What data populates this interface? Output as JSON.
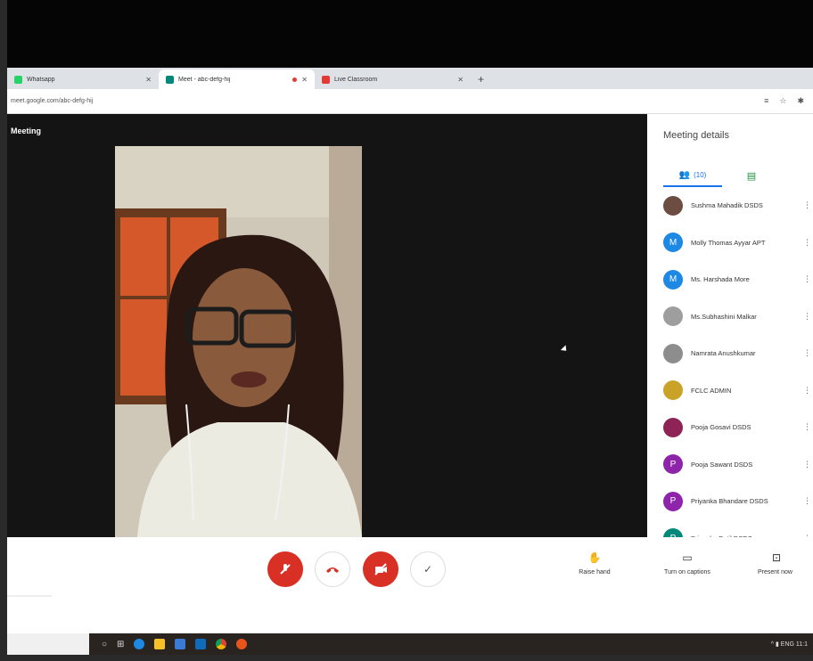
{
  "browser": {
    "tabs": [
      {
        "title": "Whatsapp",
        "favicon_color": "#25d366"
      },
      {
        "title": "Meet - abc-defg-hij",
        "favicon_color": "#00897b"
      },
      {
        "title": "Live Classroom",
        "favicon_color": "#e53935"
      }
    ],
    "new_tab": "+",
    "url": "meet.google.com/abc-defg-hij"
  },
  "meeting": {
    "title": "Meeting"
  },
  "panel": {
    "title": "Meeting details",
    "people_tab_label": "(10)",
    "participants": [
      {
        "name": "Sushma Mahadik DSDS",
        "initial": "",
        "color": "#6d4c41"
      },
      {
        "name": "Molly Thomas Ayyar APT",
        "initial": "M",
        "color": "#1e88e5"
      },
      {
        "name": "Ms. Harshada More",
        "initial": "M",
        "color": "#1e88e5"
      },
      {
        "name": "Ms.Subhashini Malkar",
        "initial": "",
        "color": "#9e9e9e"
      },
      {
        "name": "Namrata Anushkumar",
        "initial": "",
        "color": "#8d8d8d"
      },
      {
        "name": "FCLC ADMIN",
        "initial": "",
        "color": "#c9a227"
      },
      {
        "name": "Pooja Gosavi DSDS",
        "initial": "",
        "color": "#8e2456"
      },
      {
        "name": "Pooja Sawant DSDS",
        "initial": "P",
        "color": "#8e24aa"
      },
      {
        "name": "Priyanka Bhandare DSDS",
        "initial": "P",
        "color": "#8e24aa"
      },
      {
        "name": "Priyanka Patil DSDS",
        "initial": "P",
        "color": "#00897b"
      }
    ]
  },
  "controls": {
    "actions": [
      {
        "label": "Raise hand",
        "icon": "hand-icon"
      },
      {
        "label": "Turn on captions",
        "icon": "captions-icon"
      },
      {
        "label": "Present now",
        "icon": "present-icon"
      }
    ]
  },
  "taskbar": {
    "tray": "^ ▮ ENG 11:1"
  },
  "colors": {
    "meet_red": "#d93025",
    "accent_blue": "#1a73e8",
    "accent_green": "#1e8e3e"
  }
}
